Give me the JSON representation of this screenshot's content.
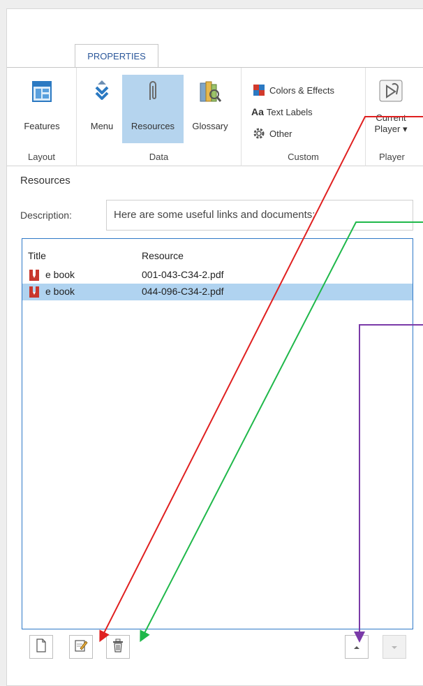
{
  "ribbon": {
    "tab_label": "PROPERTIES",
    "groups": [
      {
        "label": "Layout",
        "buttons": [
          {
            "label": "Features",
            "icon": "features-icon"
          }
        ]
      },
      {
        "label": "Data",
        "buttons": [
          {
            "label": "Menu",
            "icon": "menu-icon"
          },
          {
            "label": "Resources",
            "icon": "paperclip-icon",
            "active": true
          },
          {
            "label": "Glossary",
            "icon": "glossary-icon"
          }
        ]
      },
      {
        "label": "Custom",
        "items": [
          {
            "label": "Colors & Effects",
            "icon": "colors-effects-icon"
          },
          {
            "label": "Text Labels",
            "prefix": "Aa",
            "icon": "text-labels-icon"
          },
          {
            "label": "Other",
            "icon": "gear-icon"
          }
        ]
      },
      {
        "label": "Player",
        "buttons": [
          {
            "label_line1": "Current",
            "label_line2": "Player ▾",
            "icon": "player-icon"
          }
        ]
      }
    ]
  },
  "resources": {
    "section_title": "Resources",
    "description_label": "Description:",
    "description_value": "Here are some useful links and documents:",
    "columns": {
      "title": "Title",
      "resource": "Resource"
    },
    "rows": [
      {
        "title": "e book",
        "resource": "001-043-C34-2.pdf",
        "selected": false
      },
      {
        "title": "e book",
        "resource": "044-096-C34-2.pdf",
        "selected": true
      }
    ]
  },
  "toolbar": {
    "buttons": [
      {
        "name": "add-resource",
        "icon": "new-document-icon"
      },
      {
        "name": "edit-resource",
        "icon": "edit-icon"
      },
      {
        "name": "delete-resource",
        "icon": "trash-icon"
      },
      {
        "name": "move-up",
        "icon": "arrow-up-icon"
      },
      {
        "name": "move-down",
        "icon": "arrow-down-icon",
        "disabled": true
      }
    ]
  },
  "colors": {
    "accent": "#2b579a",
    "selection": "#b0d3f0",
    "list_border": "#2e78c7",
    "annotation_red": "#e02020",
    "annotation_green": "#1fb84a",
    "annotation_purple": "#7a3aa8"
  }
}
